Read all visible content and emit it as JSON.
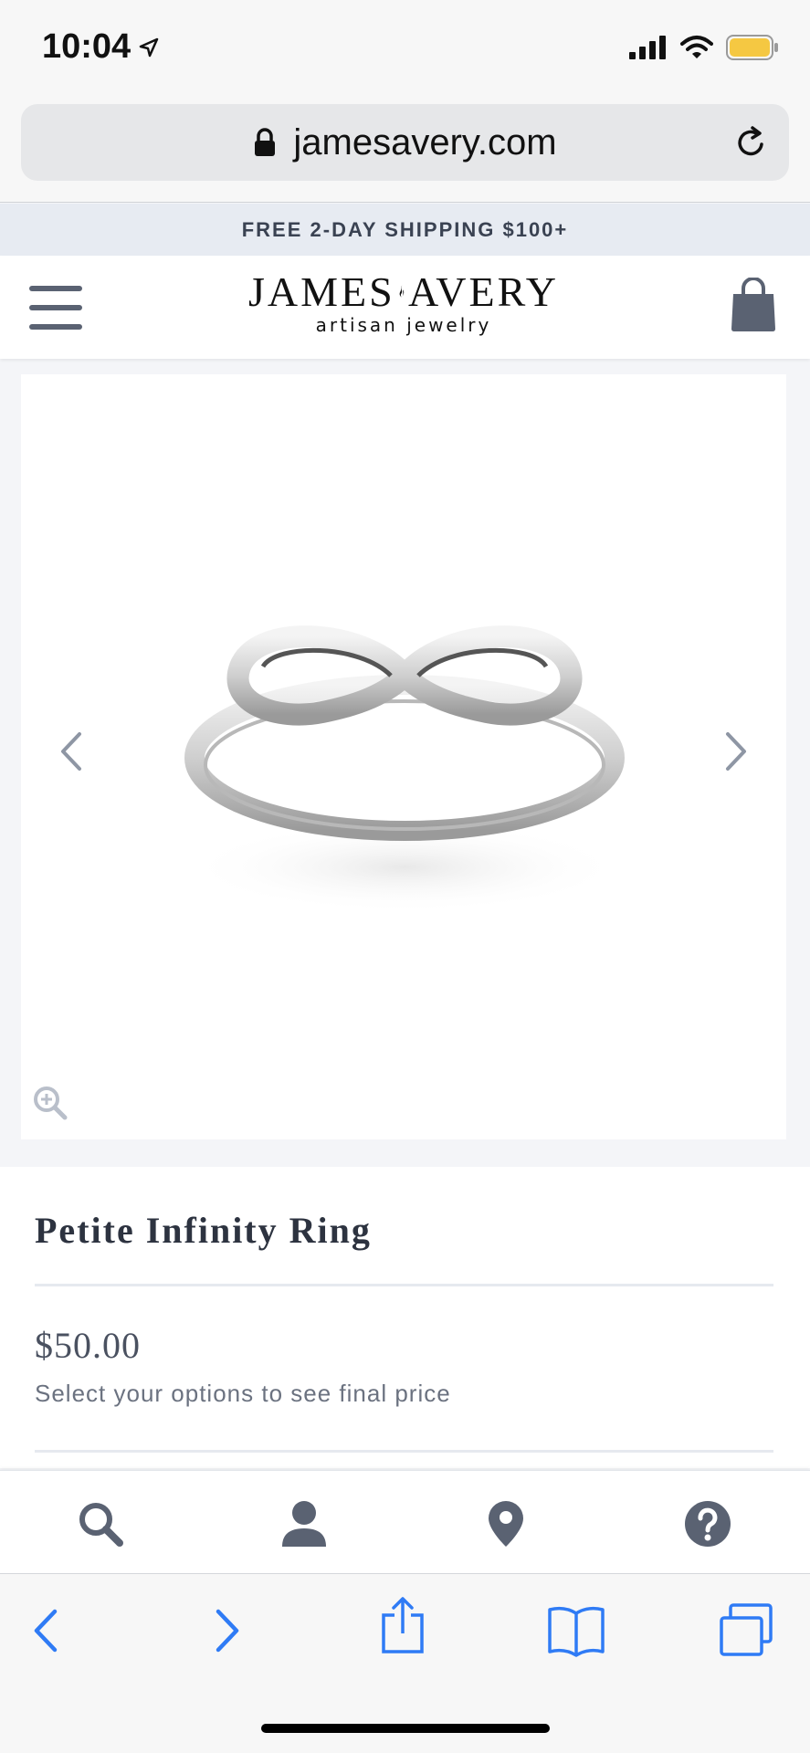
{
  "status": {
    "time": "10:04"
  },
  "browser": {
    "url": "jamesavery.com"
  },
  "promo": {
    "text": "FREE 2-DAY SHIPPING $100+"
  },
  "header": {
    "logo_left": "JAMES",
    "logo_right": "AVERY",
    "logo_sub": "artisan jewelry"
  },
  "product": {
    "name": "Petite Infinity Ring",
    "price": "$50.00",
    "price_note": "Select your options to see final price"
  },
  "bottom_nav": [
    "search-icon",
    "account-icon",
    "location-pin-icon",
    "help-icon"
  ],
  "toolbar": [
    "back-icon",
    "forward-icon",
    "share-icon",
    "bookmarks-icon",
    "tabs-icon"
  ],
  "colors": {
    "promo_bg": "#e7ebf2",
    "icon_gray": "#5a6272",
    "safari_blue": "#2f7bf5",
    "battery": "#f5c842"
  }
}
